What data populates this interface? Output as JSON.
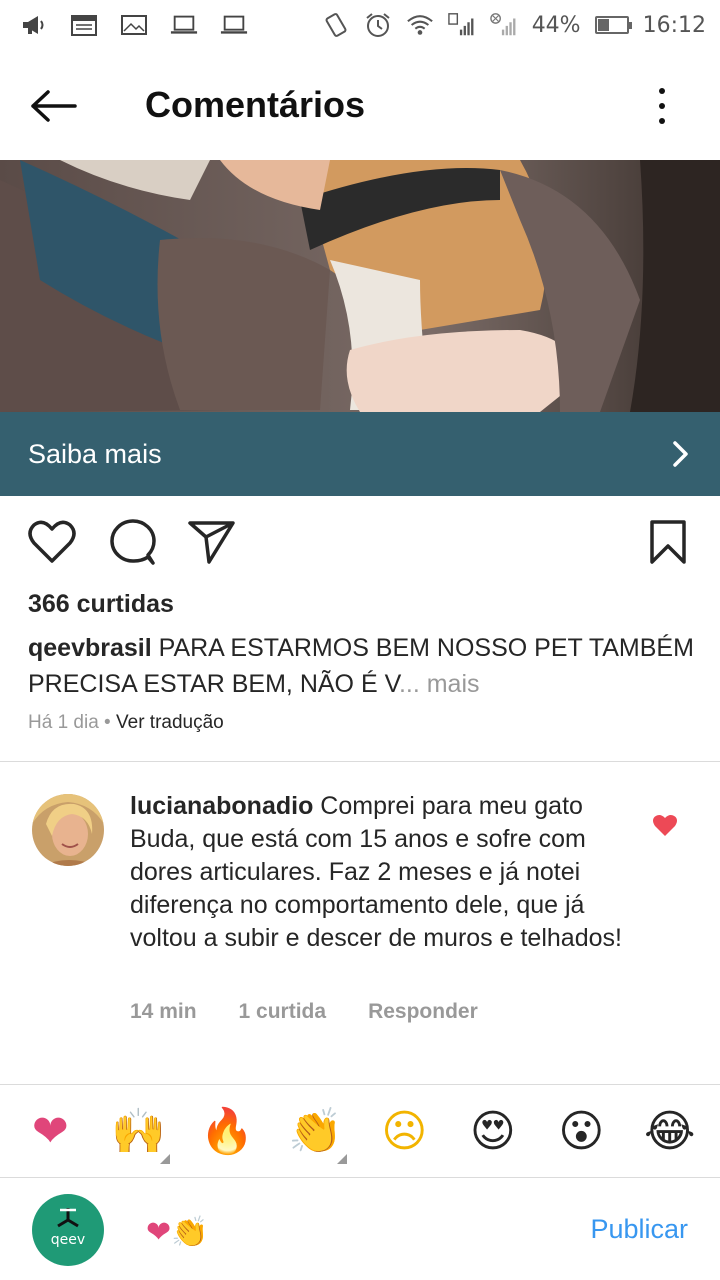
{
  "status_bar": {
    "battery": "44%",
    "battery_level": 0.44,
    "time": "16:12"
  },
  "header": {
    "title": "Comentários"
  },
  "post": {
    "cta_label": "Saiba mais",
    "likes": "366 curtidas",
    "caption_user": "qeevbrasil",
    "caption_text": " PARA ESTARMOS BEM NOSSO PET TAMBÉM PRECISA ESTAR BEM, NÃO É V",
    "caption_more": "... mais",
    "time_ago": "Há 1 dia",
    "separator": " • ",
    "translate": "Ver tradução"
  },
  "comment": {
    "user": "lucianabonadio",
    "text": " Comprei para meu gato Buda, que está com 15 anos e sofre com dores articulares. Faz 2 meses e já notei diferença no comportamento dele, que já voltou a subir e descer de muros e telhados!",
    "time": "14 min",
    "likes": "1 curtida",
    "reply": "Responder"
  },
  "emoji_bar": {
    "items": [
      "❤",
      "🙌",
      "🔥",
      "👏",
      "☹",
      "😍",
      "😮",
      "😂"
    ]
  },
  "composer": {
    "avatar_text": "qeev",
    "input_value": "❤👏",
    "publish": "Publicar"
  },
  "colors": {
    "cta_banner": "#35606f",
    "publish": "#3897f0",
    "like_red": "#ed4956",
    "composer_avatar": "#1f9a76"
  }
}
